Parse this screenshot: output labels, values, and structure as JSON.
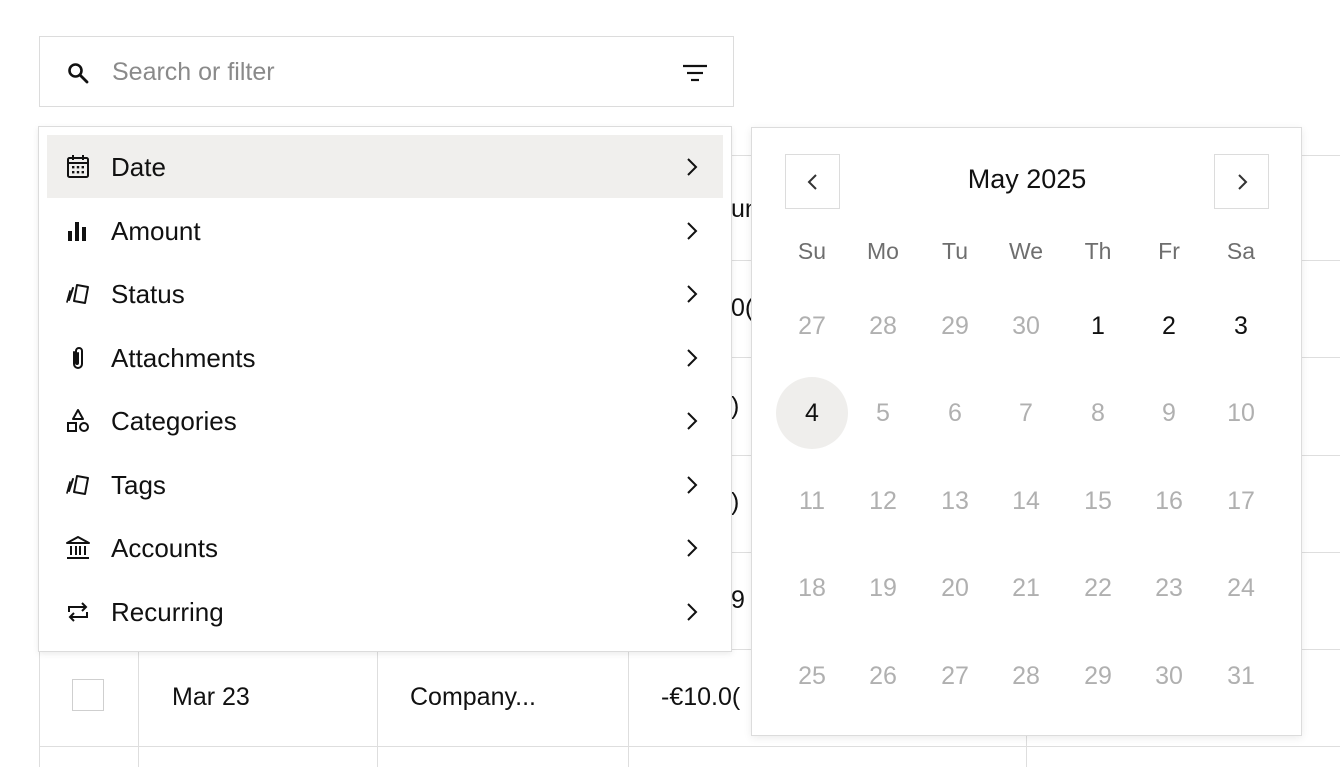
{
  "search": {
    "placeholder": "Search or filter"
  },
  "table": {
    "header_partial": "un",
    "row_fragments": [
      "0(",
      ")",
      ")",
      "9"
    ],
    "last_row": {
      "date": "Mar 23",
      "description": "Company...",
      "amount": "-€10.0("
    }
  },
  "filter_menu": {
    "items": [
      {
        "label": "Date",
        "icon": "calendar-icon",
        "active": true
      },
      {
        "label": "Amount",
        "icon": "bar-chart-icon"
      },
      {
        "label": "Status",
        "icon": "tag-icon"
      },
      {
        "label": "Attachments",
        "icon": "paperclip-icon"
      },
      {
        "label": "Categories",
        "icon": "shapes-icon"
      },
      {
        "label": "Tags",
        "icon": "tag-icon"
      },
      {
        "label": "Accounts",
        "icon": "bank-icon"
      },
      {
        "label": "Recurring",
        "icon": "repeat-icon"
      }
    ]
  },
  "calendar": {
    "month_label": "May 2025",
    "weekdays": [
      "Su",
      "Mo",
      "Tu",
      "We",
      "Th",
      "Fr",
      "Sa"
    ],
    "weeks": [
      [
        "27",
        "28",
        "29",
        "30",
        "1",
        "2",
        "3"
      ],
      [
        "4",
        "5",
        "6",
        "7",
        "8",
        "9",
        "10"
      ],
      [
        "11",
        "12",
        "13",
        "14",
        "15",
        "16",
        "17"
      ],
      [
        "18",
        "19",
        "20",
        "21",
        "22",
        "23",
        "24"
      ],
      [
        "25",
        "26",
        "27",
        "28",
        "29",
        "30",
        "31"
      ]
    ],
    "in_month_dates": [
      "1",
      "2",
      "3",
      "4"
    ],
    "today": "4"
  },
  "colors": {
    "active_item_bg": "#f0efed",
    "muted_day": "#b0b0b0",
    "border": "#dcdcdc"
  }
}
